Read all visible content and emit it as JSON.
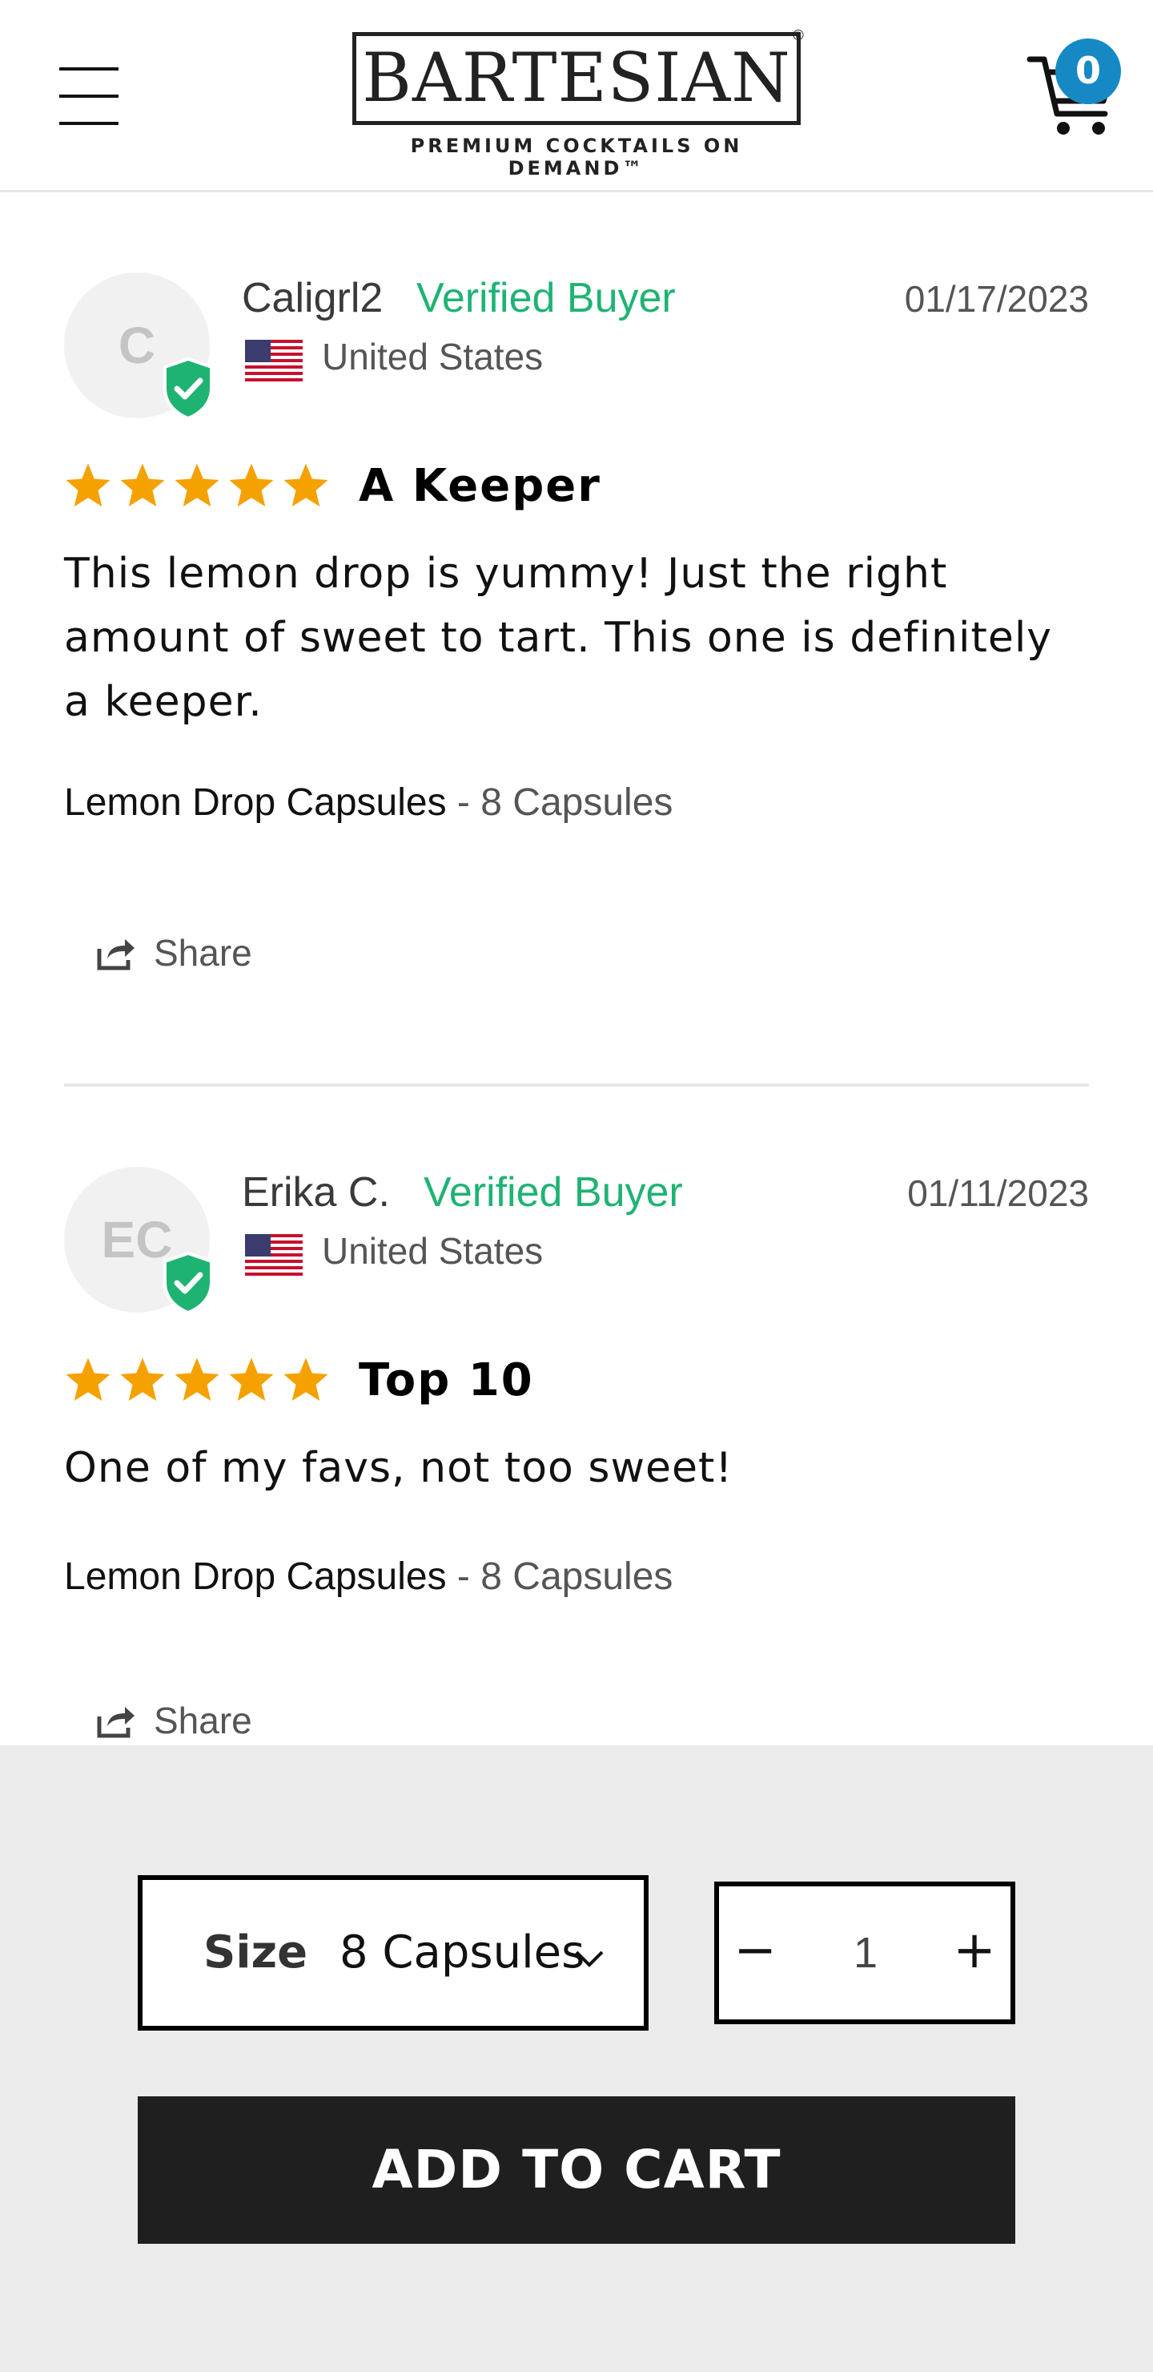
{
  "header": {
    "logo_text": "BARTESIAN",
    "logo_reg": "®",
    "tagline": "PREMIUM COCKTAILS ON DEMAND™",
    "cart_count": "0",
    "icons": {
      "menu": "hamburger-menu-icon",
      "cart": "shopping-cart-icon"
    }
  },
  "reviews": [
    {
      "initials": "C",
      "name": "Caligrl2",
      "badge": "Verified Buyer",
      "date": "01/17/2023",
      "country": "United States",
      "rating": 5,
      "title": "A Keeper",
      "body_lines": [
        "This lemon drop is yummy! Just the right",
        "amount of sweet to tart. This one is definitely",
        "a keeper."
      ],
      "product_name": "Lemon Drop Capsules",
      "product_variant": " - 8 Capsules",
      "share_label": "Share"
    },
    {
      "initials": "EC",
      "name": "Erika C.",
      "badge": "Verified Buyer",
      "date": "01/11/2023",
      "country": "United States",
      "rating": 5,
      "title": "Top 10",
      "body_lines": [
        "One of my favs, not too sweet!"
      ],
      "product_name": "Lemon Drop Capsules",
      "product_variant": " - 8 Capsules",
      "share_label": "Share"
    }
  ],
  "purchase": {
    "size_label": "Size",
    "size_value": "8 Capsules",
    "quantity": "1",
    "minus_label": "−",
    "plus_label": "+",
    "add_to_cart": "ADD TO CART"
  },
  "colors": {
    "verified_green": "#1fb373",
    "star_orange": "#f5a100",
    "cart_badge": "#1689c4",
    "button_dark": "#1f1f20",
    "bottom_bar": "#ebebeb"
  }
}
